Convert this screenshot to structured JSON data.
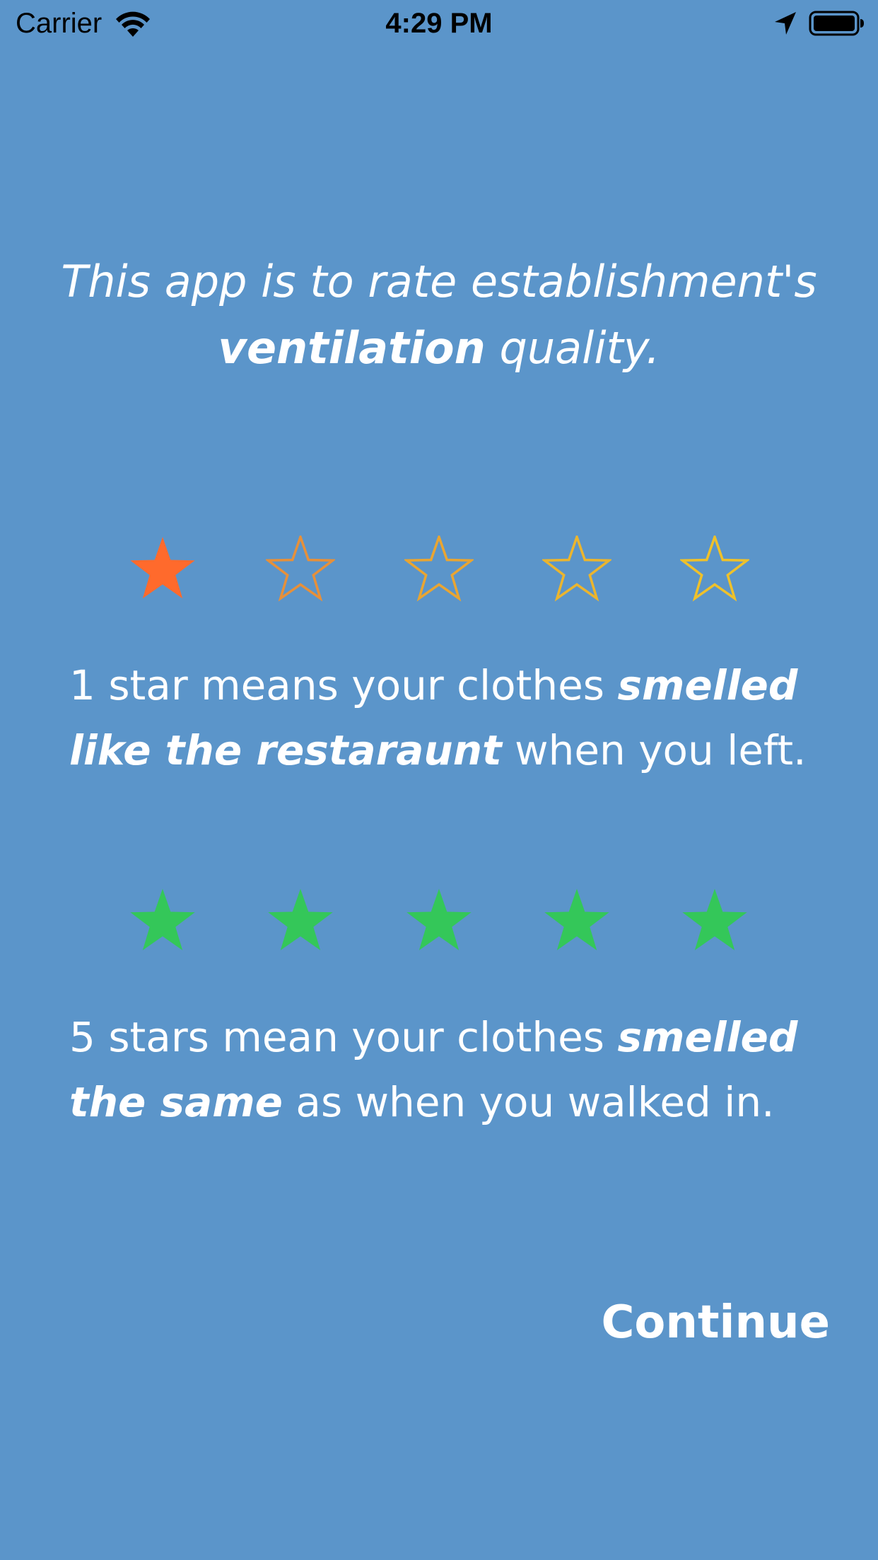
{
  "status_bar": {
    "carrier": "Carrier",
    "time": "4:29 PM",
    "wifi_icon": "wifi-icon",
    "location_icon": "location-arrow-icon",
    "battery_icon": "battery-icon"
  },
  "intro": {
    "line1": "This app is to rate establishment's",
    "bold": "ventilation",
    "rest": " quality."
  },
  "one_star": {
    "rating": 1,
    "max": 5,
    "filled_color": "#FF6A2C",
    "outline_colors": [
      "#E6903A",
      "#E9A532",
      "#EBB52E",
      "#EFC12A"
    ],
    "text_pre": "1 star means your clothes ",
    "text_bold1": "smelled",
    "text_bold2": "like the restaraunt",
    "text_post": " when you left."
  },
  "five_star": {
    "rating": 5,
    "max": 5,
    "filled_color": "#34C759",
    "text_pre": "5 stars mean your clothes ",
    "text_bold1": "smelled",
    "text_bold2": "the same",
    "text_post": " as when you walked in."
  },
  "actions": {
    "continue_label": "Continue"
  },
  "colors": {
    "background": "#5B95CA",
    "text": "#FFFFFF"
  }
}
